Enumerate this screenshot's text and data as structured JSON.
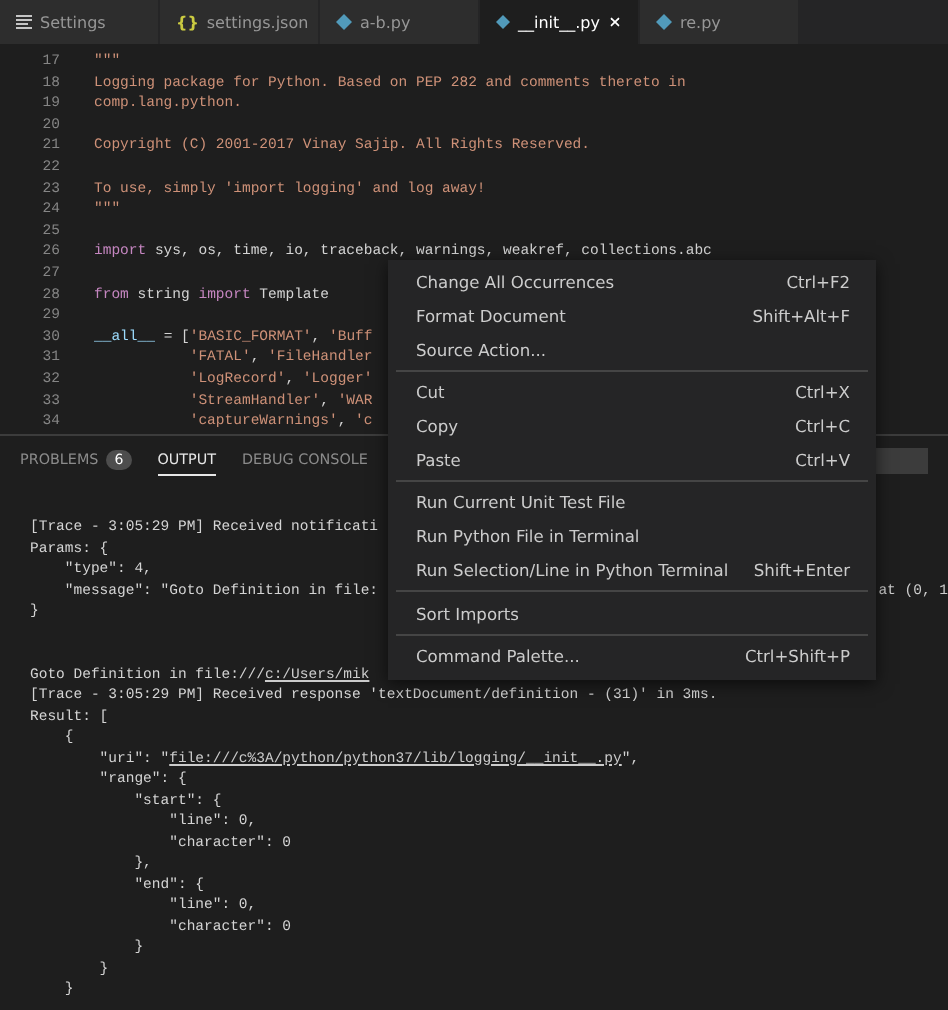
{
  "tabs": [
    {
      "label": "Settings",
      "kind": "lines",
      "selected": false
    },
    {
      "label": "settings.json",
      "kind": "braces",
      "glyph": "{}",
      "selected": false
    },
    {
      "label": "a-b.py",
      "kind": "python",
      "selected": false
    },
    {
      "label": "__init__.py",
      "kind": "python",
      "selected": true
    },
    {
      "label": "re.py",
      "kind": "python",
      "selected": false
    }
  ],
  "editor": {
    "lines": [
      {
        "number": "17",
        "segments": [
          {
            "kind": "str",
            "t": "\"\"\""
          }
        ]
      },
      {
        "number": "18",
        "segments": [
          {
            "kind": "str",
            "t": "Logging package for Python. Based on PEP 282 and comments thereto in"
          }
        ]
      },
      {
        "number": "19",
        "segments": [
          {
            "kind": "str",
            "t": "comp.lang.python."
          }
        ]
      },
      {
        "number": "20"
      },
      {
        "number": "21",
        "segments": [
          {
            "kind": "str",
            "t": "Copyright (C) 2001-2017 Vinay Sajip. All Rights Reserved."
          }
        ]
      },
      {
        "number": "22"
      },
      {
        "number": "23",
        "segments": [
          {
            "kind": "str",
            "t": "To use, simply 'import logging' and log away!"
          }
        ]
      },
      {
        "number": "24",
        "segments": [
          {
            "kind": "str",
            "t": "\"\"\""
          }
        ]
      },
      {
        "number": "25"
      },
      {
        "number": "26",
        "segments": [
          {
            "kind": "kw",
            "t": "import"
          },
          {
            "kind": "plain",
            "t": " sys, os, time, io, traceback, warnings, weakref, collections.abc"
          }
        ]
      },
      {
        "number": "27"
      },
      {
        "number": "28",
        "segments": [
          {
            "kind": "kw",
            "t": "from"
          },
          {
            "kind": "plain",
            "t": " string "
          },
          {
            "kind": "kw",
            "t": "import"
          },
          {
            "kind": "plain",
            "t": " Template"
          }
        ]
      },
      {
        "number": "29"
      },
      {
        "number": "30",
        "segments": [
          {
            "kind": "name",
            "t": "__all__"
          },
          {
            "kind": "plain",
            "t": " = ["
          },
          {
            "kind": "str",
            "t": "'BASIC_FORMAT'"
          },
          {
            "kind": "plain",
            "t": ", "
          },
          {
            "kind": "str",
            "t": "'Buff"
          }
        ]
      },
      {
        "number": "31",
        "segments": [
          {
            "kind": "str",
            "t": "           'FATAL'"
          },
          {
            "kind": "plain",
            "t": ", "
          },
          {
            "kind": "str",
            "t": "'FileHandler"
          }
        ]
      },
      {
        "number": "32",
        "segments": [
          {
            "kind": "str",
            "t": "           'LogRecord'"
          },
          {
            "kind": "plain",
            "t": ", "
          },
          {
            "kind": "str",
            "t": "'Logger'"
          }
        ]
      },
      {
        "number": "33",
        "segments": [
          {
            "kind": "str",
            "t": "           'StreamHandler'"
          },
          {
            "kind": "plain",
            "t": ", "
          },
          {
            "kind": "str",
            "t": "'WAR"
          }
        ]
      },
      {
        "number": "34",
        "segments": [
          {
            "kind": "str",
            "t": "           'captureWarnings'"
          },
          {
            "kind": "plain",
            "t": ", "
          },
          {
            "kind": "str",
            "t": "'c"
          }
        ]
      }
    ]
  },
  "panel": {
    "tabs": [
      {
        "label": "PROBLEMS",
        "badge": "6",
        "selected": false
      },
      {
        "label": "OUTPUT",
        "selected": true
      },
      {
        "label": "DEBUG CONSOLE",
        "selected": false
      }
    ],
    "output_blocks": [
      [
        {
          "segments": [
            {
              "kind": "plain",
              "t": "[Trace - 3:05:29 PM] Received notificati"
            }
          ]
        },
        {
          "segments": [
            {
              "kind": "plain",
              "t": "Params: {"
            }
          ]
        },
        {
          "segments": [
            {
              "kind": "plain",
              "t": "    \"type\": 4,"
            }
          ]
        },
        {
          "segments": [
            {
              "kind": "plain",
              "t": "    \"message\": \"Goto Definition in file:"
            }
          ],
          "right": "at (0, 1"
        },
        {
          "segments": [
            {
              "kind": "plain",
              "t": "}"
            }
          ]
        }
      ],
      [
        {
          "segments": [
            {
              "kind": "plain",
              "t": "Goto Definition in file:///"
            },
            {
              "kind": "link",
              "t": "c:/Users/mik"
            }
          ]
        },
        {
          "segments": [
            {
              "kind": "plain",
              "t": "[Trace - 3:05:29 PM] Received response 'textDocument/definition - (31)' in 3ms."
            }
          ]
        },
        {
          "segments": [
            {
              "kind": "plain",
              "t": "Result: ["
            }
          ]
        },
        {
          "segments": [
            {
              "kind": "plain",
              "t": "    {"
            }
          ]
        },
        {
          "segments": [
            {
              "kind": "plain",
              "t": "        \"uri\": \""
            },
            {
              "kind": "link",
              "t": "file:///c%3A/python/python37/lib/logging/__init__.py"
            },
            {
              "kind": "plain",
              "t": "\","
            }
          ]
        },
        {
          "segments": [
            {
              "kind": "plain",
              "t": "        \"range\": {"
            }
          ]
        },
        {
          "segments": [
            {
              "kind": "plain",
              "t": "            \"start\": {"
            }
          ]
        },
        {
          "segments": [
            {
              "kind": "plain",
              "t": "                \"line\": 0,"
            }
          ]
        },
        {
          "segments": [
            {
              "kind": "plain",
              "t": "                \"character\": 0"
            }
          ]
        },
        {
          "segments": [
            {
              "kind": "plain",
              "t": "            },"
            }
          ]
        },
        {
          "segments": [
            {
              "kind": "plain",
              "t": "            \"end\": {"
            }
          ]
        },
        {
          "segments": [
            {
              "kind": "plain",
              "t": "                \"line\": 0,"
            }
          ]
        },
        {
          "segments": [
            {
              "kind": "plain",
              "t": "                \"character\": 0"
            }
          ]
        },
        {
          "segments": [
            {
              "kind": "plain",
              "t": "            }"
            }
          ]
        },
        {
          "segments": [
            {
              "kind": "plain",
              "t": "        }"
            }
          ]
        },
        {
          "segments": [
            {
              "kind": "plain",
              "t": "    }"
            }
          ]
        }
      ]
    ]
  },
  "context_menu": {
    "groups": [
      [
        {
          "label": "Change All Occurrences",
          "shortcut": "Ctrl+F2"
        },
        {
          "label": "Format Document",
          "shortcut": "Shift+Alt+F"
        },
        {
          "label": "Source Action..."
        }
      ],
      [
        {
          "label": "Cut",
          "shortcut": "Ctrl+X"
        },
        {
          "label": "Copy",
          "shortcut": "Ctrl+C"
        },
        {
          "label": "Paste",
          "shortcut": "Ctrl+V"
        }
      ],
      [
        {
          "label": "Run Current Unit Test File"
        },
        {
          "label": "Run Python File in Terminal"
        },
        {
          "label": "Run Selection/Line in Python Terminal",
          "shortcut": "Shift+Enter"
        }
      ],
      [
        {
          "label": "Sort Imports"
        }
      ],
      [
        {
          "label": "Command Palette...",
          "shortcut": "Ctrl+Shift+P"
        }
      ]
    ]
  }
}
